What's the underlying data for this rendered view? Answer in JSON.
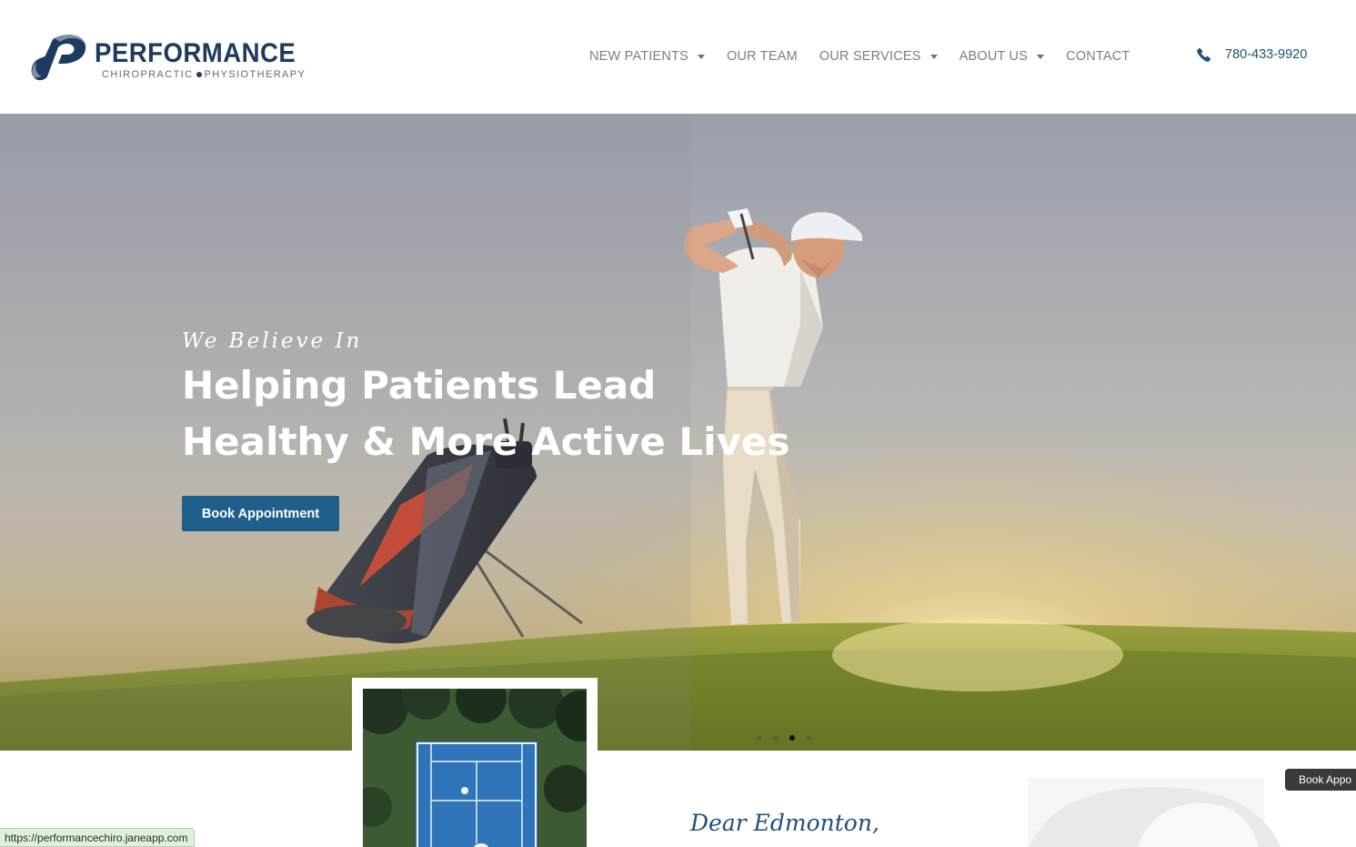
{
  "brand": {
    "name": "PERFORMANCE",
    "subtitle_left": "CHIROPRACTIC",
    "subtitle_right": "PHYSIOTHERAPY",
    "color_primary": "#1d3a5f"
  },
  "nav": {
    "items": [
      {
        "label": "NEW PATIENTS",
        "dropdown": true
      },
      {
        "label": "OUR TEAM",
        "dropdown": false
      },
      {
        "label": "OUR SERVICES",
        "dropdown": true
      },
      {
        "label": "ABOUT US",
        "dropdown": true
      },
      {
        "label": "CONTACT",
        "dropdown": false
      }
    ],
    "phone": "780-433-9920",
    "phone_icon": "phone-icon"
  },
  "hero": {
    "script_line": "We Believe In",
    "title_line_1": "Helping Patients Lead",
    "title_line_2": "Healthy & More Active Lives",
    "cta_label": "Book Appointment",
    "cta_color": "#1f5f8b",
    "slides_total": 4,
    "active_slide": 3
  },
  "intro": {
    "greeting": "Dear Edmonton,"
  },
  "floating_button": {
    "label": "Book Appo"
  },
  "status_bar": {
    "url": "https://performancechiro.janeapp.com"
  }
}
